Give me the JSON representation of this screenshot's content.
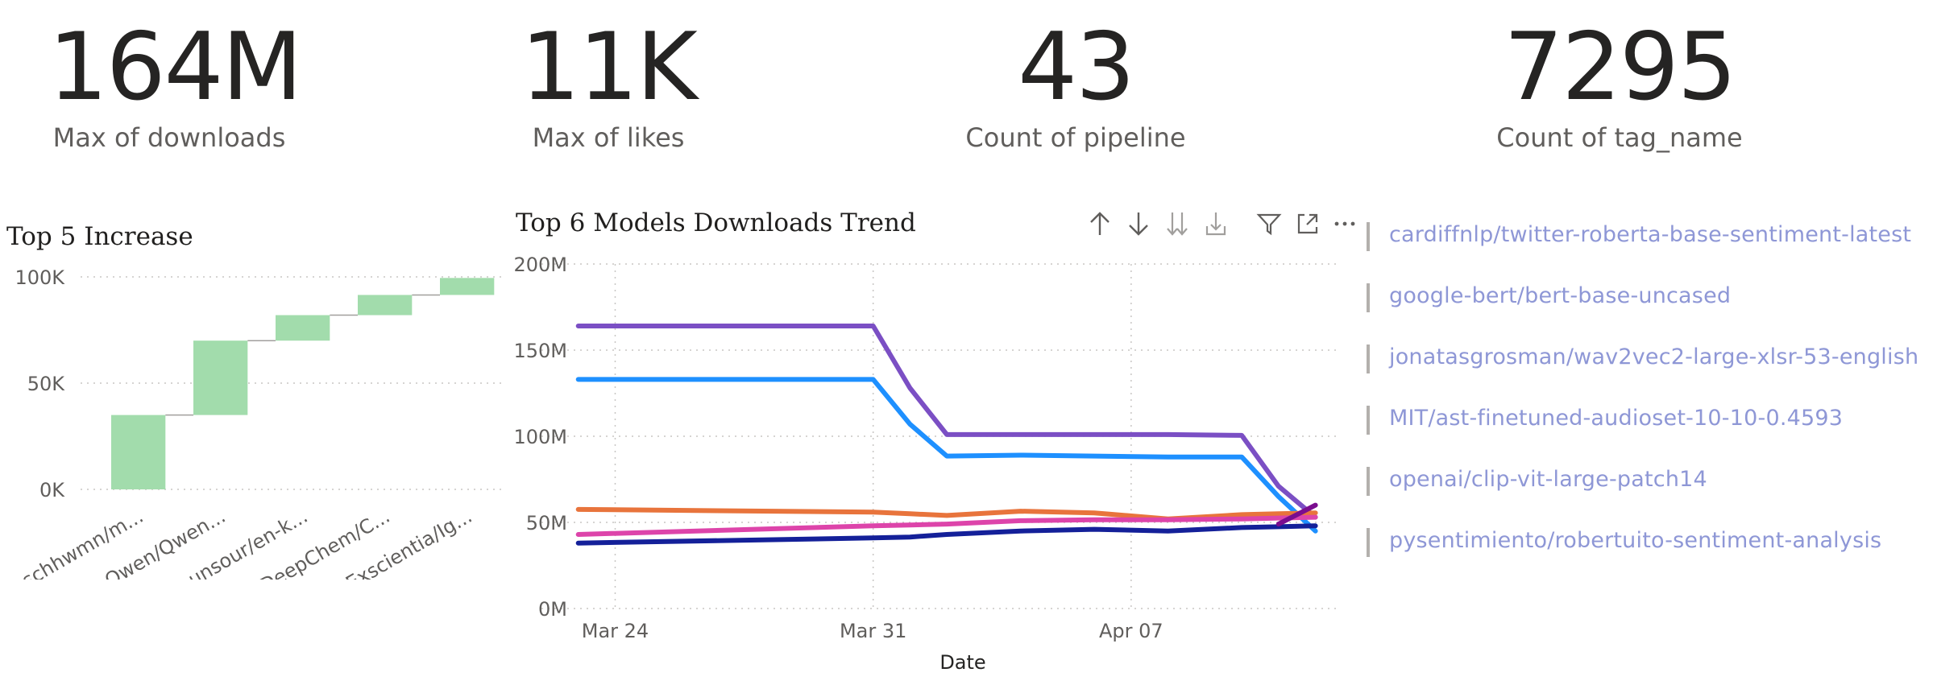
{
  "kpis": [
    {
      "value": "164M",
      "label": "Max of downloads"
    },
    {
      "value": "11K",
      "label": "Max of likes"
    },
    {
      "value": "43",
      "label": "Count of pipeline"
    },
    {
      "value": "7295",
      "label": "Count of tag_name"
    }
  ],
  "colors": {
    "waterfall_bar": "#a2dcac",
    "connector": "#a19f9d",
    "series": [
      "#7b4fc4",
      "#1e90ff",
      "#e8743c",
      "#dd44aa",
      "#142099",
      "#7a0d8f"
    ]
  },
  "toolbar": {
    "icons": [
      "sort-up-icon",
      "sort-down-icon",
      "expand-all-down-icon",
      "drill-down-icon",
      "filter-icon",
      "focus-mode-icon",
      "more-options-icon"
    ]
  },
  "legend": [
    "cardiffnlp/twitter-roberta-base-sentiment-latest",
    "google-bert/bert-base-uncased",
    "jonatasgrosman/wav2vec2-large-xlsr-53-english",
    "MIT/ast-finetuned-audioset-10-10-0.4593",
    "openai/clip-vit-large-patch14",
    "pysentimiento/robertuito-sentiment-analysis"
  ],
  "chart_data": [
    {
      "type": "bar",
      "subtype": "waterfall",
      "title": "Top 5 Increase",
      "categories": [
        "schhwmn/m...",
        "Qwen/Qwen...",
        "eunsour/en-k...",
        "DeepChem/C...",
        "Exscientia/Ig..."
      ],
      "values": [
        35000,
        35000,
        12000,
        9500,
        8000
      ],
      "ylim": [
        0,
        100000
      ],
      "yticks": [
        "0K",
        "50K",
        "100K"
      ],
      "grid": true
    },
    {
      "type": "line",
      "title": "Top 6 Models Downloads Trend",
      "xlabel": "Date",
      "ylabel": "",
      "xticks": [
        "Mar 24",
        "Mar 31",
        "Apr 07"
      ],
      "yticks": [
        "0M",
        "50M",
        "100M",
        "150M",
        "200M"
      ],
      "ylim": [
        0,
        200000000
      ],
      "x": [
        "2024-03-23",
        "2024-03-31",
        "2024-04-01",
        "2024-04-02",
        "2024-04-04",
        "2024-04-06",
        "2024-04-08",
        "2024-04-10",
        "2024-04-11",
        "2024-04-12"
      ],
      "series": [
        {
          "values": [
            164000000,
            164000000,
            128000000,
            101000000,
            101000000,
            101000000,
            101000000,
            100500000,
            71000000,
            53000000
          ]
        },
        {
          "values": [
            133000000,
            133000000,
            107000000,
            88500000,
            89000000,
            88500000,
            88000000,
            88000000,
            65000000,
            45000000
          ]
        },
        {
          "values": [
            57500000,
            56000000,
            55000000,
            54000000,
            56500000,
            55500000,
            52000000,
            54500000,
            55000000,
            55500000
          ]
        },
        {
          "values": [
            43000000,
            48000000,
            48500000,
            49000000,
            51000000,
            51500000,
            51500000,
            52000000,
            52500000,
            53000000
          ]
        },
        {
          "values": [
            38000000,
            41000000,
            41500000,
            43000000,
            45000000,
            46000000,
            45000000,
            47000000,
            47500000,
            48000000
          ]
        },
        {
          "values": [
            null,
            null,
            null,
            null,
            null,
            null,
            null,
            null,
            49000000,
            60000000
          ]
        }
      ],
      "grid": true
    }
  ]
}
